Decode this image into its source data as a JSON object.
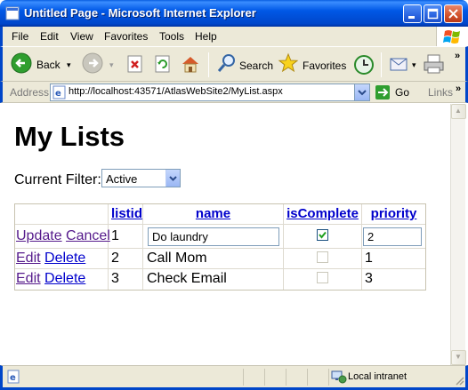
{
  "window": {
    "title": "Untitled Page - Microsoft Internet Explorer"
  },
  "menu": [
    "File",
    "Edit",
    "View",
    "Favorites",
    "Tools",
    "Help"
  ],
  "toolbar": {
    "back": "Back",
    "search": "Search",
    "favorites": "Favorites"
  },
  "address": {
    "label": "Address",
    "url": "http://localhost:43571/AtlasWebSite2/MyList.aspx",
    "go": "Go",
    "links": "Links"
  },
  "page": {
    "title": "My Lists",
    "filter_label": "Current Filter:",
    "filter_value": "Active",
    "grid": {
      "headers": [
        "listid",
        "name",
        "isComplete",
        "priority"
      ],
      "edit_row": {
        "update": "Update",
        "cancel": "Cancel",
        "listid": "1",
        "name": "Do laundry",
        "isComplete": true,
        "priority": "2"
      },
      "rows": [
        {
          "edit": "Edit",
          "delete": "Delete",
          "listid": "2",
          "name": "Call Mom",
          "isComplete": false,
          "priority": "1"
        },
        {
          "edit": "Edit",
          "delete": "Delete",
          "listid": "3",
          "name": "Check Email",
          "isComplete": false,
          "priority": "3"
        }
      ]
    }
  },
  "status": {
    "zone": "Local intranet"
  }
}
